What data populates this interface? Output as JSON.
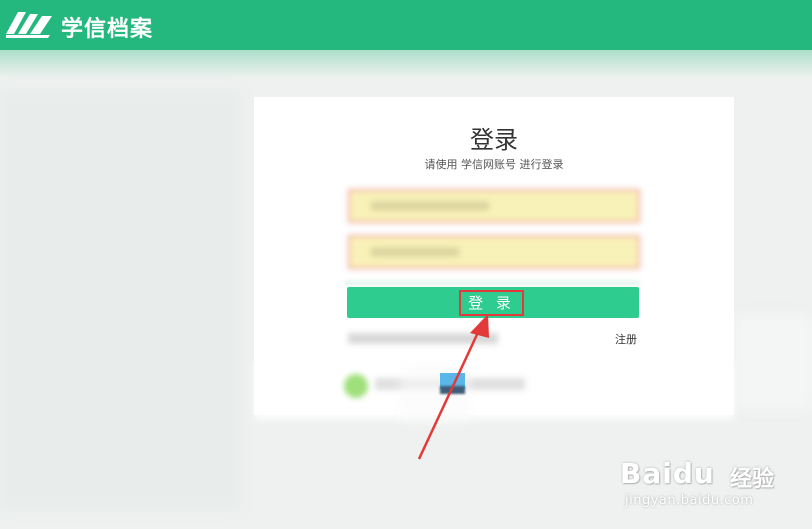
{
  "header": {
    "app_name": "学信档案",
    "logo_icon": "book-stack-icon"
  },
  "login": {
    "title": "登录",
    "subtitle": "请使用 学信网账号 进行登录",
    "submit_label": "登 录",
    "register_label": "注册"
  },
  "watermark": {
    "logo_text": "Baidu",
    "brand_text": "经验",
    "url_text": "jingyan.baidu.com"
  },
  "colors": {
    "accent": "#25b87e",
    "button": "#2ecc8f",
    "annotation": "#e23a3a"
  }
}
